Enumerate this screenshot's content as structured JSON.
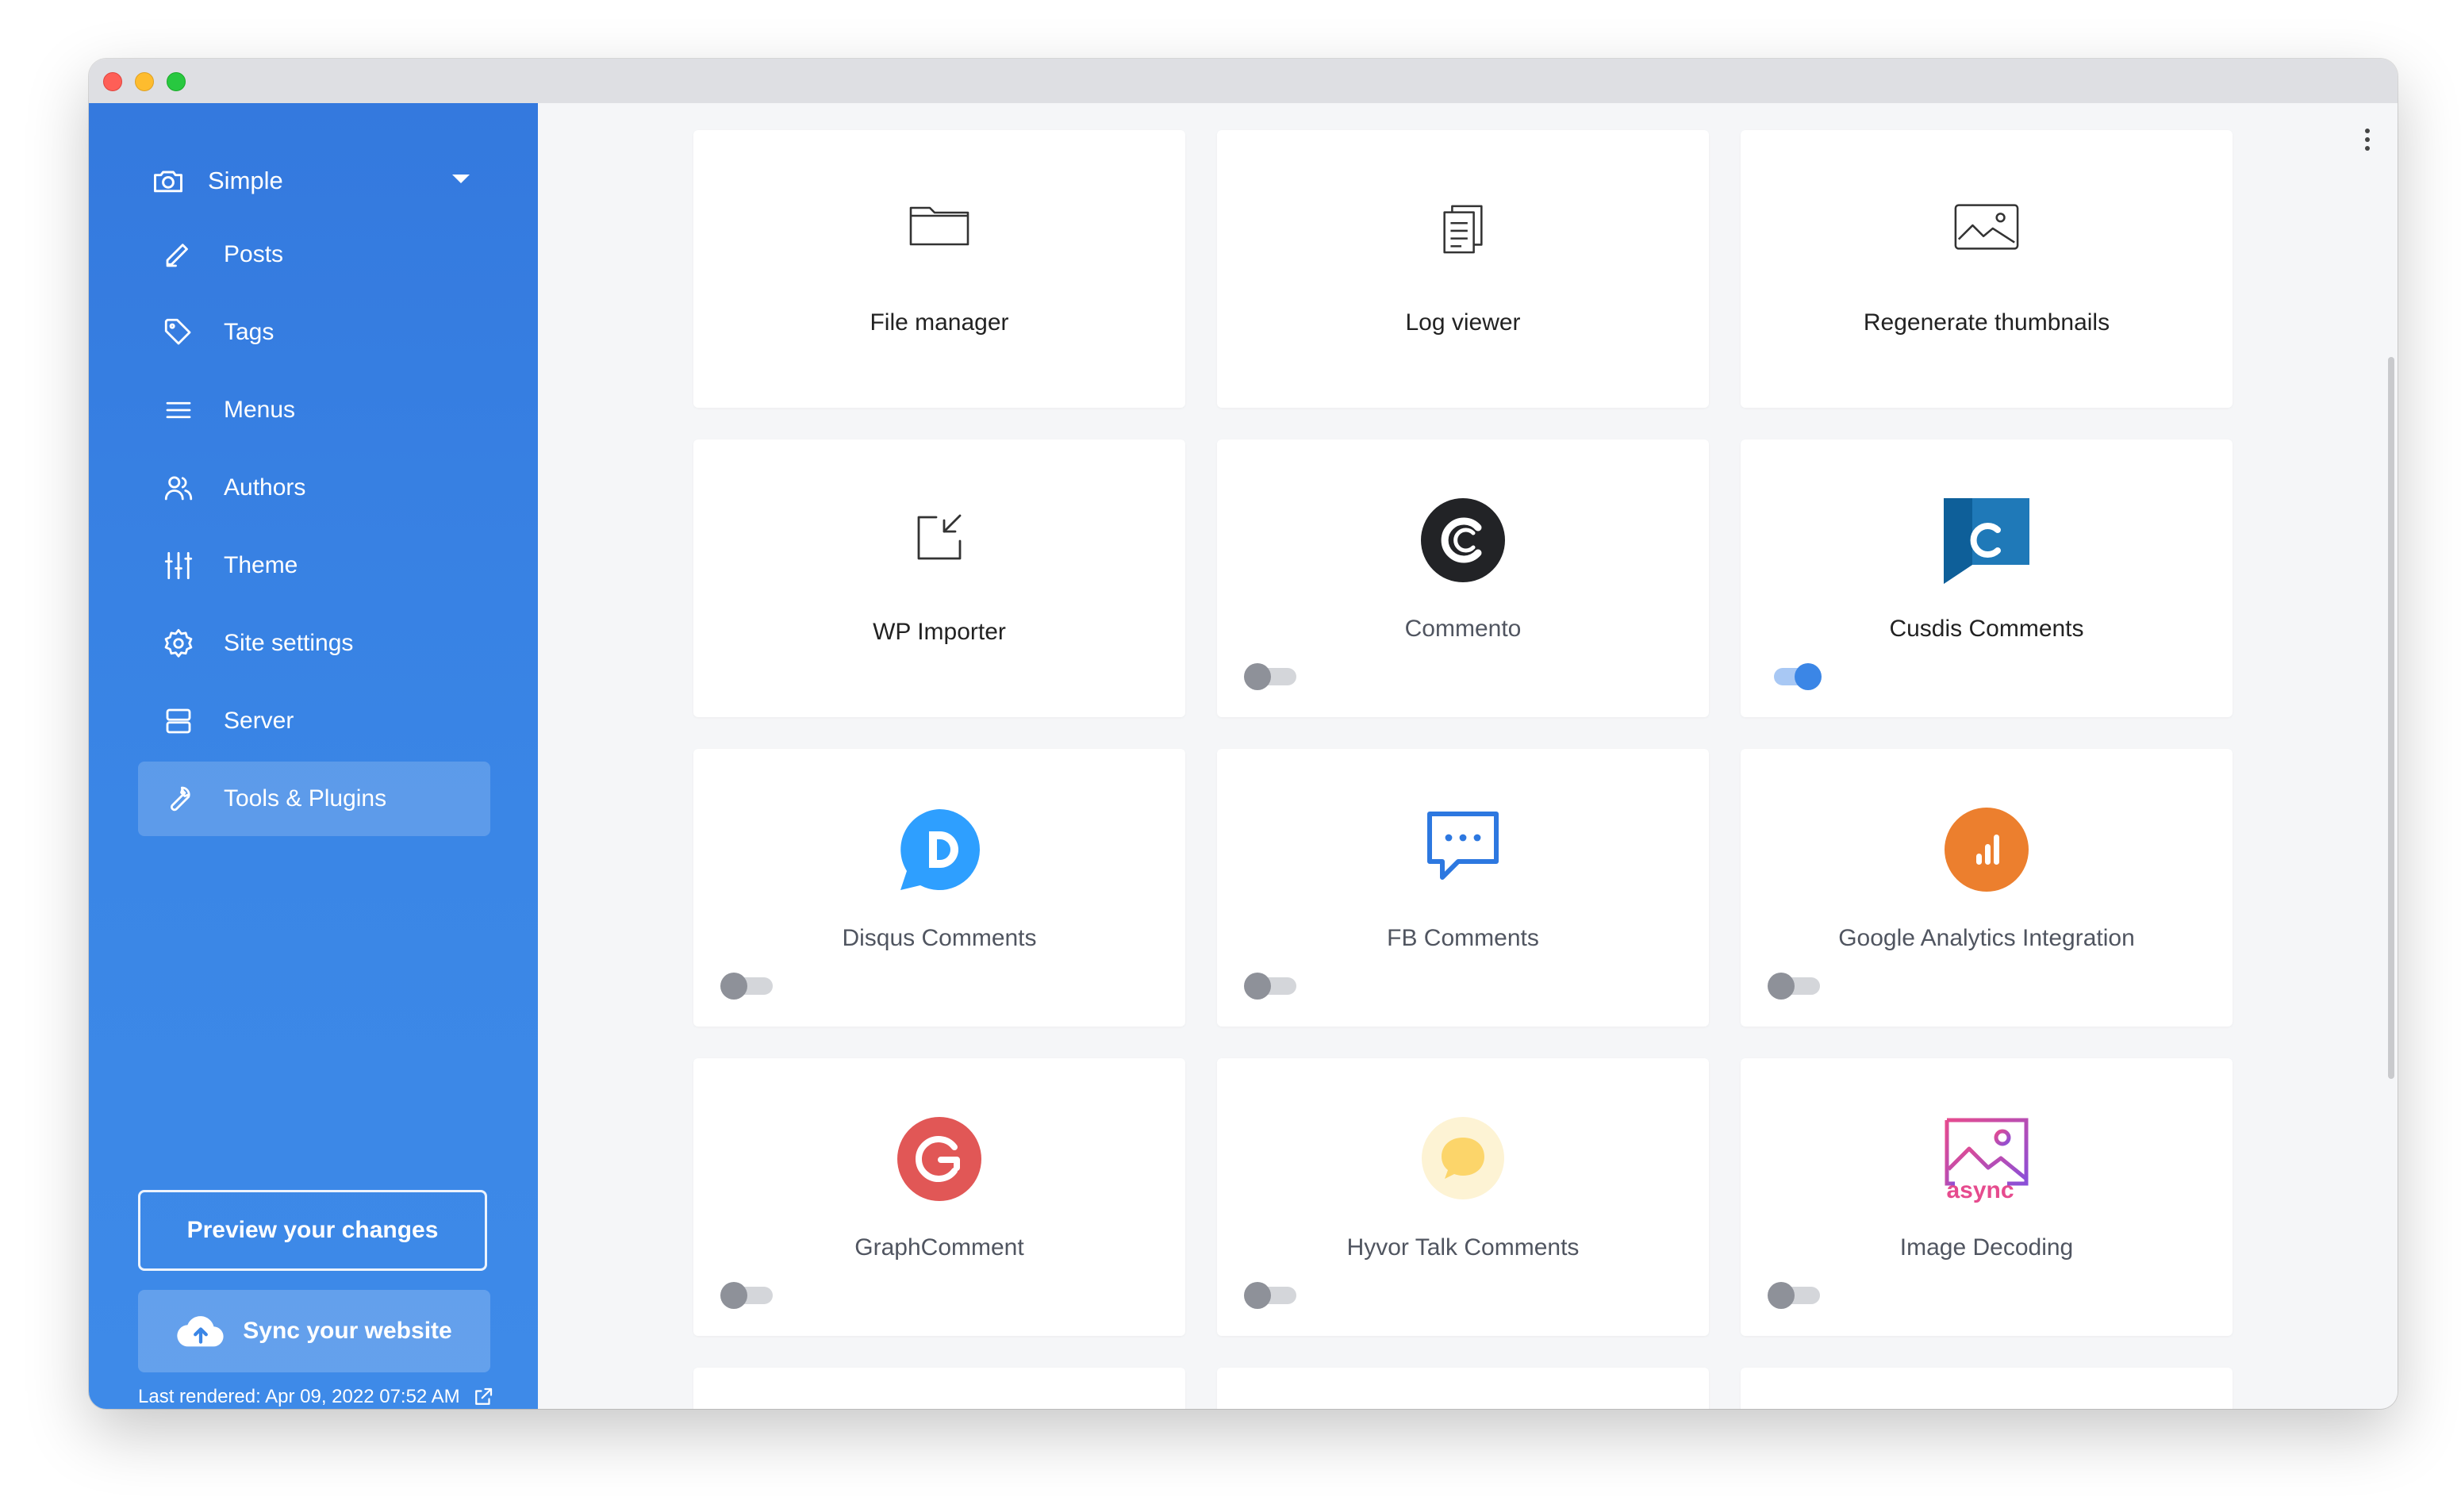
{
  "sidebar": {
    "site_name": "Simple",
    "site_icon": "camera-icon",
    "items": [
      {
        "label": "Posts",
        "icon": "pencil-icon"
      },
      {
        "label": "Tags",
        "icon": "tag-icon"
      },
      {
        "label": "Menus",
        "icon": "menu-icon"
      },
      {
        "label": "Authors",
        "icon": "users-icon"
      },
      {
        "label": "Theme",
        "icon": "sliders-icon"
      },
      {
        "label": "Site settings",
        "icon": "gear-icon"
      },
      {
        "label": "Server",
        "icon": "server-icon"
      },
      {
        "label": "Tools & Plugins",
        "icon": "wrench-icon",
        "active": true
      }
    ],
    "preview_label": "Preview your changes",
    "sync_label": "Sync your website",
    "last_rendered": "Last rendered: Apr 09, 2022 07:52 AM"
  },
  "tools": [
    {
      "name": "File manager",
      "icon": "folder-icon"
    },
    {
      "name": "Log viewer",
      "icon": "document-icon"
    },
    {
      "name": "Regenerate thumbnails",
      "icon": "image-icon"
    },
    {
      "name": "WP Importer",
      "icon": "import-icon"
    }
  ],
  "plugins": [
    {
      "name": "Commento",
      "icon": "commento-logo-icon",
      "enabled": false
    },
    {
      "name": "Cusdis Comments",
      "icon": "cusdis-logo-icon",
      "enabled": true
    },
    {
      "name": "Disqus Comments",
      "icon": "disqus-logo-icon",
      "enabled": false
    },
    {
      "name": "FB Comments",
      "icon": "chat-bubble-icon",
      "enabled": false
    },
    {
      "name": "Google Analytics Integration",
      "icon": "analytics-logo-icon",
      "enabled": false
    },
    {
      "name": "GraphComment",
      "icon": "graphcomment-logo-icon",
      "enabled": false
    },
    {
      "name": "Hyvor Talk Comments",
      "icon": "hyvor-logo-icon",
      "enabled": false
    },
    {
      "name": "Image Decoding",
      "icon": "async-image-icon",
      "icon_text": "async",
      "enabled": false
    }
  ],
  "colors": {
    "sidebar": "#3479de",
    "accent": "#3b86e6",
    "toggle_off": "#8e9199"
  }
}
